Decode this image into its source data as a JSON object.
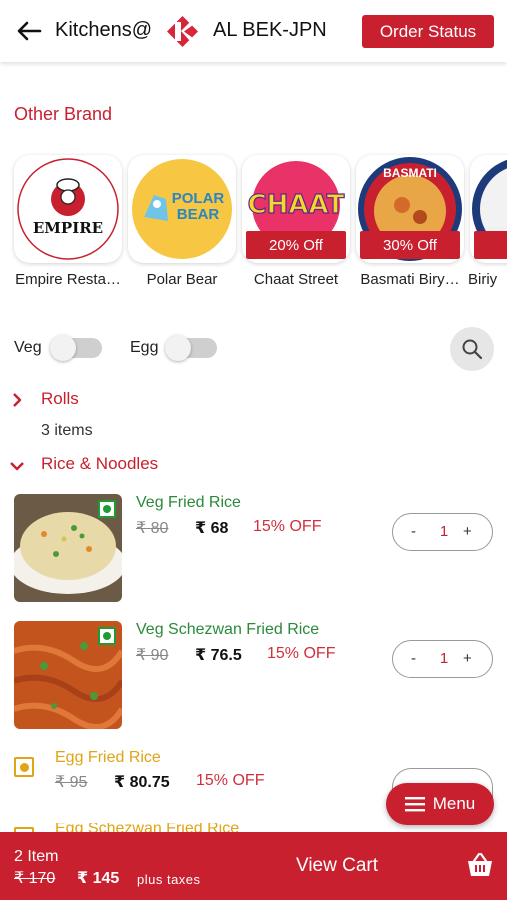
{
  "header": {
    "title": "Kitchens@",
    "brand": "AL BEK-JPN",
    "order_status": "Order Status"
  },
  "other_brand": {
    "title": "Other Brand",
    "brands": [
      {
        "name": "Empire Resta…",
        "offer": "",
        "logo_text": "EMPIRE"
      },
      {
        "name": "Polar Bear",
        "offer": "",
        "logo_text": "POLAR BEAR"
      },
      {
        "name": "Chaat Street",
        "offer": "20% Off",
        "logo_text": "CHAAT"
      },
      {
        "name": "Basmati Biry…",
        "offer": "30% Off",
        "logo_text": "BASMATI"
      },
      {
        "name": "Biriy",
        "offer": "",
        "logo_text": ""
      }
    ]
  },
  "filters": {
    "veg_label": "Veg",
    "egg_label": "Egg",
    "veg_on": false,
    "egg_on": false
  },
  "categories": [
    {
      "name": "Rolls",
      "count": "3 items",
      "expanded": false
    },
    {
      "name": "Rice & Noodles",
      "expanded": true
    }
  ],
  "items": [
    {
      "name": "Veg Fried Rice",
      "mrp": "₹ 80",
      "price": "₹ 68",
      "off": "15% OFF",
      "qty": "1",
      "minus": "-",
      "plus": "+"
    },
    {
      "name": "Veg Schezwan Fried Rice",
      "mrp": "₹ 90",
      "price": "₹ 76.5",
      "off": "15% OFF",
      "qty": "1",
      "minus": "-",
      "plus": "+"
    }
  ],
  "egg_items": [
    {
      "name": "Egg Fried Rice",
      "mrp": "₹ 95",
      "price": "₹ 80.75",
      "off": "15% OFF"
    },
    {
      "name": "Egg Schezwan Fried Rice"
    }
  ],
  "menu_button": "Menu",
  "cart": {
    "items": "2 Item",
    "mrp": "₹ 170",
    "total": "₹ 145",
    "tax_note": "plus taxes",
    "view_cart": "View Cart"
  },
  "colors": {
    "accent": "#c8202f",
    "veg": "#1e9b33",
    "egg": "#e0a414"
  }
}
